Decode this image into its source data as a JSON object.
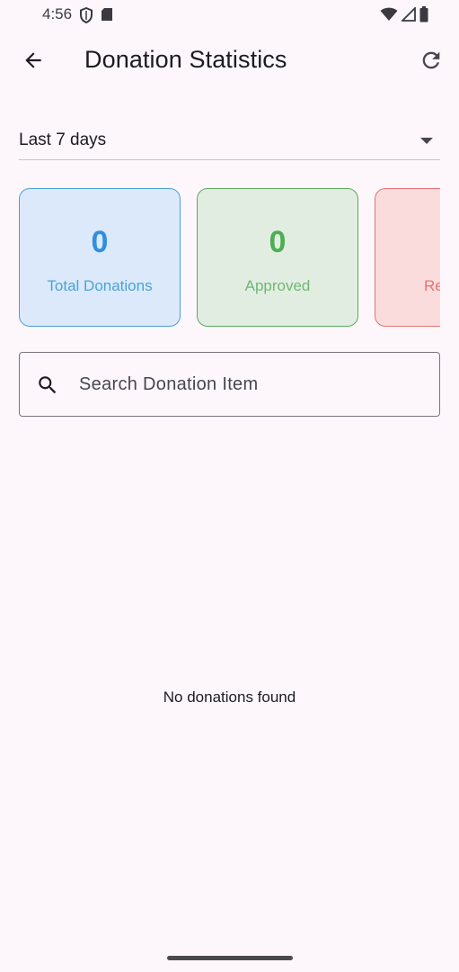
{
  "status_bar": {
    "time": "4:56",
    "left_icons": [
      "shield-icon",
      "sd-card-icon"
    ],
    "right_icons": [
      "wifi-icon",
      "signal-icon",
      "battery-icon"
    ]
  },
  "app_bar": {
    "title": "Donation Statistics",
    "back_icon": "arrow-back-icon",
    "refresh_icon": "refresh-icon"
  },
  "period": {
    "selected": "Last 7 days"
  },
  "stats": [
    {
      "value": "0",
      "label": "Total Donations",
      "color": "#2f8fe0"
    },
    {
      "value": "0",
      "label": "Approved",
      "color": "#4caf50"
    },
    {
      "value": "",
      "label": "Re",
      "color": "#e53935"
    }
  ],
  "search": {
    "placeholder": "Search Donation Item",
    "value": ""
  },
  "empty_state": {
    "message": "No donations found"
  },
  "colors": {
    "background": "#fdf7fc",
    "total_accent": "#2f8fe0",
    "approved_accent": "#4caf50",
    "rejected_accent": "#e57373"
  }
}
